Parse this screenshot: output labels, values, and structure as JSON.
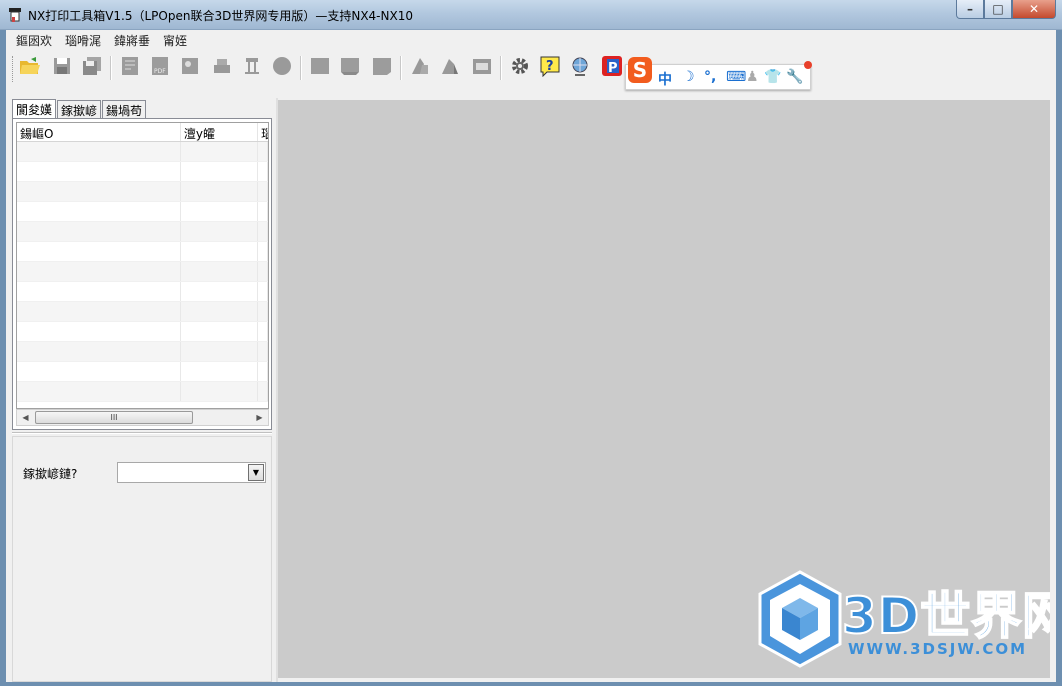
{
  "window": {
    "title": "NX打印工具箱V1.5（LPOpen联合3D世界网专用版）—支持NX4-NX10"
  },
  "menu": [
    "鏂囦欢",
    "瑙嗗浘",
    "鍏嶈垂",
    "甯姪"
  ],
  "ime": {
    "brand": "S",
    "items": [
      "中",
      "☽",
      "°,",
      "⌨",
      "♟",
      "👕",
      "🔧"
    ]
  },
  "left_panel": {
    "tabs": [
      "閬夋嫨",
      "鎵撳嵃",
      "鍚堝苟"
    ],
    "active_tab": 0,
    "grid": {
      "columns": [
        "鍚嶇О",
        "澶у皬",
        "瑙"
      ],
      "rows": 13
    },
    "print_label": "鎵撳嵃鏈?",
    "print_value": ""
  },
  "watermark": {
    "text": "3D世界网",
    "url": "WWW.3DSJW.COM"
  }
}
